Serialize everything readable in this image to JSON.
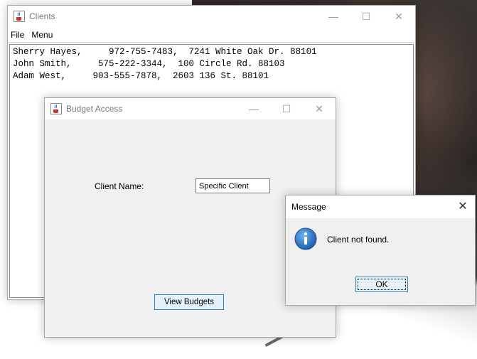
{
  "clients_window": {
    "title": "Clients",
    "menu": [
      "File",
      "Menu"
    ],
    "lines": [
      "Sherry Hayes,     972-755-7483,  7241 White Oak Dr. 88101",
      "John Smith,     575-222-3344,  100 Circle Rd. 88103",
      "Adam West,     903-555-7878,  2603 136 St. 88101"
    ]
  },
  "budget_window": {
    "title": "Budget Access",
    "client_label": "Client Name:",
    "client_value": "Specific Client",
    "view_button": "View Budgets"
  },
  "message_dialog": {
    "title": "Message",
    "text": "Client not found.",
    "ok_button": "OK"
  },
  "controls": {
    "minimize": "—",
    "maximize": "☐",
    "close": "✕"
  },
  "colors": {
    "button_border": "#3c7fb1",
    "button_fill": "#e5f1fb",
    "info_icon": "#1c6fc4"
  }
}
